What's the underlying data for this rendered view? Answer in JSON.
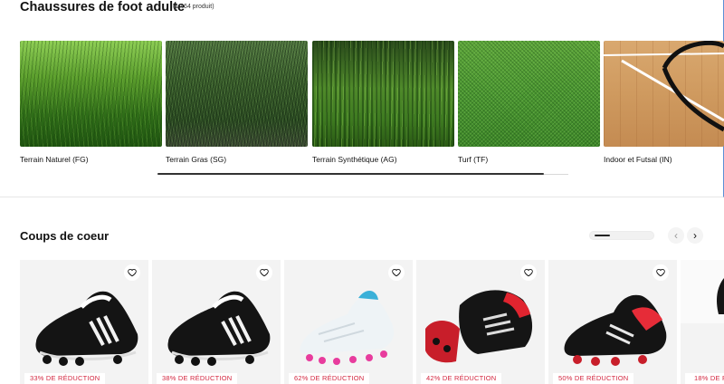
{
  "category": {
    "title": "Chaussures de foot adulte",
    "count": "(1 464 produit)"
  },
  "surfaces": [
    {
      "label": "Terrain Naturel (FG)"
    },
    {
      "label": "Terrain Gras (SG)"
    },
    {
      "label": "Terrain Synthétique (AG)"
    },
    {
      "label": "Turf (TF)"
    },
    {
      "label": "Indoor et Futsal (IN)"
    }
  ],
  "favorites": {
    "title": "Coups de coeur",
    "nav": {
      "prev": "‹",
      "next": "›"
    },
    "products": [
      {
        "discount": "33% DE RÉDUCTION"
      },
      {
        "discount": "38% DE RÉDUCTION"
      },
      {
        "discount": "62% DE RÉDUCTION"
      },
      {
        "discount": "42% DE RÉDUCTION"
      },
      {
        "discount": "50% DE RÉDUCTION"
      },
      {
        "discount": "18% DE RÉ"
      }
    ]
  },
  "colors": {
    "discount_red": "#d3263f",
    "card_bg": "#f3f3f3",
    "accent_border": "#5b8fd6"
  }
}
